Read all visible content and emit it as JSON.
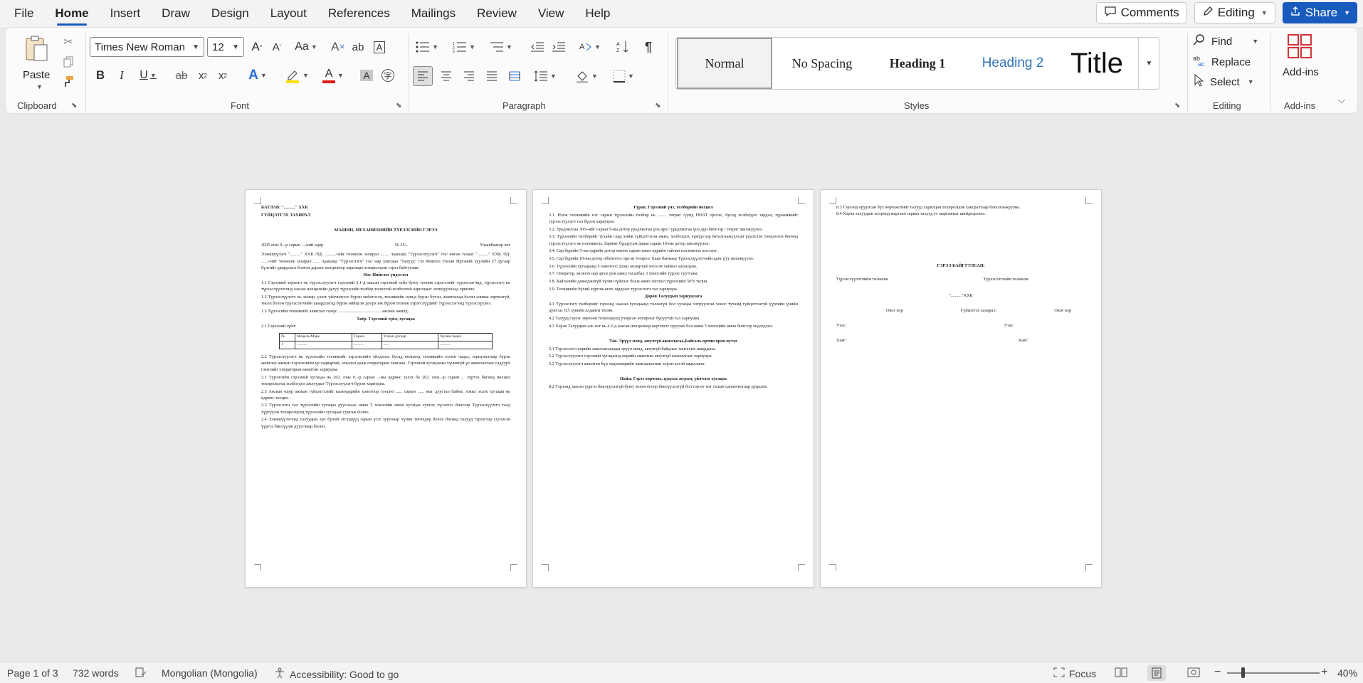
{
  "menu": {
    "tabs": [
      "File",
      "Home",
      "Insert",
      "Draw",
      "Design",
      "Layout",
      "References",
      "Mailings",
      "Review",
      "View",
      "Help"
    ],
    "active": "Home",
    "comments_label": "Comments",
    "editing_label": "Editing",
    "share_label": "Share"
  },
  "ribbon": {
    "clipboard": {
      "label": "Clipboard",
      "paste_label": "Paste"
    },
    "font": {
      "label": "Font",
      "font_name": "Times New Roman",
      "font_size": "12"
    },
    "paragraph": {
      "label": "Paragraph"
    },
    "styles": {
      "label": "Styles",
      "items": [
        "Normal",
        "No Spacing",
        "Heading 1",
        "Heading 2",
        "Title"
      ]
    },
    "editing": {
      "label": "Editing",
      "find": "Find",
      "replace": "Replace",
      "select": "Select"
    },
    "addins": {
      "label": "Add-ins",
      "button": "Add-ins"
    }
  },
  "document": {
    "page1": {
      "approve": "БАТЛАВ: \"..........\" ХХК",
      "approve2": "ГҮЙЦЭТГЭХ ЗАХИРАЛ",
      "title": "МАШИН, МЕХАНИЗМИЙН ТҮРЭЭСИЙН ГЭРЭЭ",
      "date": "2025 оны 0..-р сарын ...-ний өдөр",
      "number": "№ 25/..",
      "place": "Улаанбаатар хот",
      "intro": "Эзэмшүүлэгч \"..........\" ХХК /РД: ........../-ийг төлөөлж захирал ........ /цаашид \"Түрээслүүлэгч\" гэх/ нөгөө талаас \"..........\" ХХК /РД: ....../-ийг төлөөлж захирал ...... /цаашид \"Түрээслэгч\" гэх/ нар хамтдаа \"Талууд\" гэх Монгол Улсын Иргэний хуулийн 27 дугаар бүлгийг удирдлага болгон дараах нөхцөлөөр харилцан тохиролцож гэрээ байгуулав.",
      "s1": "Нэг. Нийтлэг үндэслэл",
      "s1_text": "1.1 Гэрээний зорилго нь түрээслүүлэгч гэрээний 2.1-д заасан гэрээний зүйл буюу техник хэрэгслийг түрээслэгчид, түрээслэгч нь түрээслүүлэгчид заасан нөхцөлийн дагуу түрээсийн төлбөр төлөхтэй холбоотой харилцааг зохицуулахад оршино.",
      "s1_text2": "1.2 Түрээслүүлэгч нь засвар, үзлэг үйлчилгээг бүрэн хийлгэсэн, техникийн хувьд бүрэн бүтэн, ашиглахад бэлэн аливаа зөрчилгүй, төсөл болон түрээслэгчийн шаардлагад бүрэн нийцсэн доорх иж бүрэн техник хэрэгслүүдийг Түрээслэгчид түрээслүүлнэ.",
      "s1_text3": "1.3 Түрээсийн техникийг ашиглах газар: ........................................ажлын ажилд.",
      "s2": "Хоёр. Гэрээний зүйл, хугацаа",
      "s2_text": "2.1 Гэрээний зүйл:",
      "table_header": [
        "№",
        "Модель,Марк",
        "Төрөл",
        "Улсын дугаар",
        "Хүчин чадал"
      ],
      "table_row": [
        "1",
        "..........",
        "..........",
        "......",
        ".........."
      ],
      "s2_text2": "2.2 Түрээслүүлэгч нь түрээсийн техникийг хэрэгжлийн үйлдлээс бусад нөхцөлд техникийн хүчин чадал, зориулалтаар бүрэн ашиглах ажлын хэрэгжлийн ур чадвартай, ачаалал дааж операторын хангана. Гэрээний хугацааны хүчингүй үе ашиглалтаас гадуурх гэмтлийг операторын ажилтан хариуцна.",
      "s2_text3": "2.1 Түрээсийн гэрээний хугацаа нь 202. оны 0..-р сарын ..-ны өдрөөс эхлэх ба 202. оны..-р сарын ... хүртэл бөгөөд нөхцөл тохиролцоод холбогдох ажлуудыг Түрээслүүлэгч бүрэн хариуцна.",
      "s2_text4": "2.3 Ажлын өдөр ажлын гүйцэтгэлийг календарийн хоногоор тооцно ...... сарын ...... ныг дуустал байна. Ажил эхлэх хугацаа нь өдрөөс тооцно.",
      "s2_text5": "2.3 Түрээслэгч тал түрээсийн хугацаа дуусахаас өмнө 5 хоногийн өмнө хугацаа сунгах хүсэлтээ бичгээр Түрээслүүлэгч талд хүргүүлж тохиролцоод түрээсийн хугацааг сунгаж болно.",
      "s2_text6": "2.4 Эзэмшүүлэгчид талуудын эрх бүхий этгээдүүд гарын үсэг зурснаар хүчин төгөлдөр болох бөгөөд талууд гэрээгээр хүлээсэн үүргээ биелүүлж дуусгавар болно."
    },
    "page2": {
      "s3": "Гурав. Гэрээний үнэ, төлбөрийн нөхцөл",
      "s3_items": [
        "3.1. Нэгж техникийн нэг сарын түрээсийн төлбөр нь ........ төгрөг /үүнд НӨАТ орсон/, бусад холбогдох зардал, хураамжийг түрээслүүлэгч тал бүрэн хариуцна.",
        "3.2. Урьдчилгаа 30%-ийг сарын 5-ны дотор урьдчилгаа үнэ дүн / урьдчилгаа үнэ дүн бичгээр / төгрөг шилжүүлнэ.",
        "3.3. Түрээсийн төлбөрийг тухайн сард хийж гүйцэтгэсэн ажил, холбогдох хүмүүсээр баталгаажуулсан үндэслэн тооцоолох бөгөөд түрээслүүлэгч нь нэхэмжлэх, баримт бүрдүүлж дараа сарын 10-ны дотор шилжүүлнэ.",
        "3.4. Сар бүрийн 5-ны өдрийн дотор өмнөх сарын ажил өдрийн тайлан нэхэмжлэх илгээнэ.",
        "3.5. Сар бүрийн 10-ны дотор объектоос ирсэн тооцоог Хаан банкаар Түрээслүүлэгчийн данс руу шилжүүлнэ.",
        "3.6. Түрээсийн хугацаанд 5 хоногоос дээш засвартай зогсолт хийвэл хасагдана.",
        "3.7. Оператор, жолооч нар архи ууж ажил тасалбал 3 хоногийн түрээс суутгана.",
        "3.8. Байгалийн давагдашгүй хүчин зүйлээс болж ажил зогсвол түрээсийн 50% төлнө.",
        "3.9. Техникийн бүхий хүргэж өгөх зардлыг түрээслэгч тал хариуцна."
      ],
      "s4": "Дөрөв.Талуудын хариуцлага",
      "s4_items": [
        "4.1 Түрээслэгч төлбөрийг гэрээнд заасан хугацаанд төлөөгүй бол хугацаа хэтрүүлсэн хоног тутамд гүйцэтгээгүй үүргийн үнийн дүнгээс 0,5 хувийн алданги төлнө.",
        "4.2 Талууд гэрээг зөрчсөн тохиолдолд учирсан хохирлыг буруутай тал хариуцна.",
        "4.3 Хэрэв Талуудын аль нэг нь 4.2-д заасан нөхцөлөөр өөрчлөлт оруулах бол өмнө 5 хоногийн өмнө бичгээр мэдэгдэнэ."
      ],
      "s5": "Тав. Эрүүл мэнд, аюулгүй ажиллагаа,Байгаль орчин орон нутаг",
      "s5_items": [
        "5.1 Түрээслэгч өөрийн ажиллагаандаа эрүүл мэнд, аюулгүй байдлыг хангахыг шаардана.",
        "5.2 Түрээслүүлэгч гэрээний хугацаанд өөрийн ажилтны аюулгүй ажиллагааг хариуцна.",
        "5.3 Түрээслүүлэгч ажилтан бүр хөдөлмөрийн хамгаалалтын хэрэгсэлтэй ажиллана."
      ],
      "s6": "Найм. Гэрээ өөрчлөх, цуцлах журам, үйлчлэх хугацаа",
      "s6_items": [
        "8.2 Гэрээнд заасан үүргээ биелүүлээгүй буюу зохих ёсоор биелүүлээгүй бол гэрээг нэг талын санаачилгаар цуцална."
      ]
    },
    "page3": {
      "top": "8.3 Гэрээнд оруулсан бүх өөрчлөлтийг талууд харилцан тохиролцож хавсралтаар баталгаажуулна.\n8.4 Хэрэв талуудын хооронд маргаан гарвал талууд уг маргааныг шийдвэрлэнэ.",
      "sign_title": "ГЭРЭЭ БАЙГУУЛСАН:",
      "left_party": "Түрээслүүлэгчийн төлөөлж",
      "right_party": "Түрээслэгчийн төлөөлж",
      "company": "\"..........\"ХХК",
      "left_sign": "Овог нэр",
      "mid_sign": "Гүйцэтгэх захирал:",
      "right_sign": "Овог нэр",
      "phone_left": "Утас:",
      "phone_right": "Утас:",
      "addr_left": "Хаяг:",
      "addr_right": "Хаяг:"
    }
  },
  "status": {
    "page": "Page 1 of 3",
    "words": "732 words",
    "language": "Mongolian (Mongolia)",
    "accessibility": "Accessibility: Good to go",
    "focus": "Focus",
    "zoom": "40%"
  }
}
